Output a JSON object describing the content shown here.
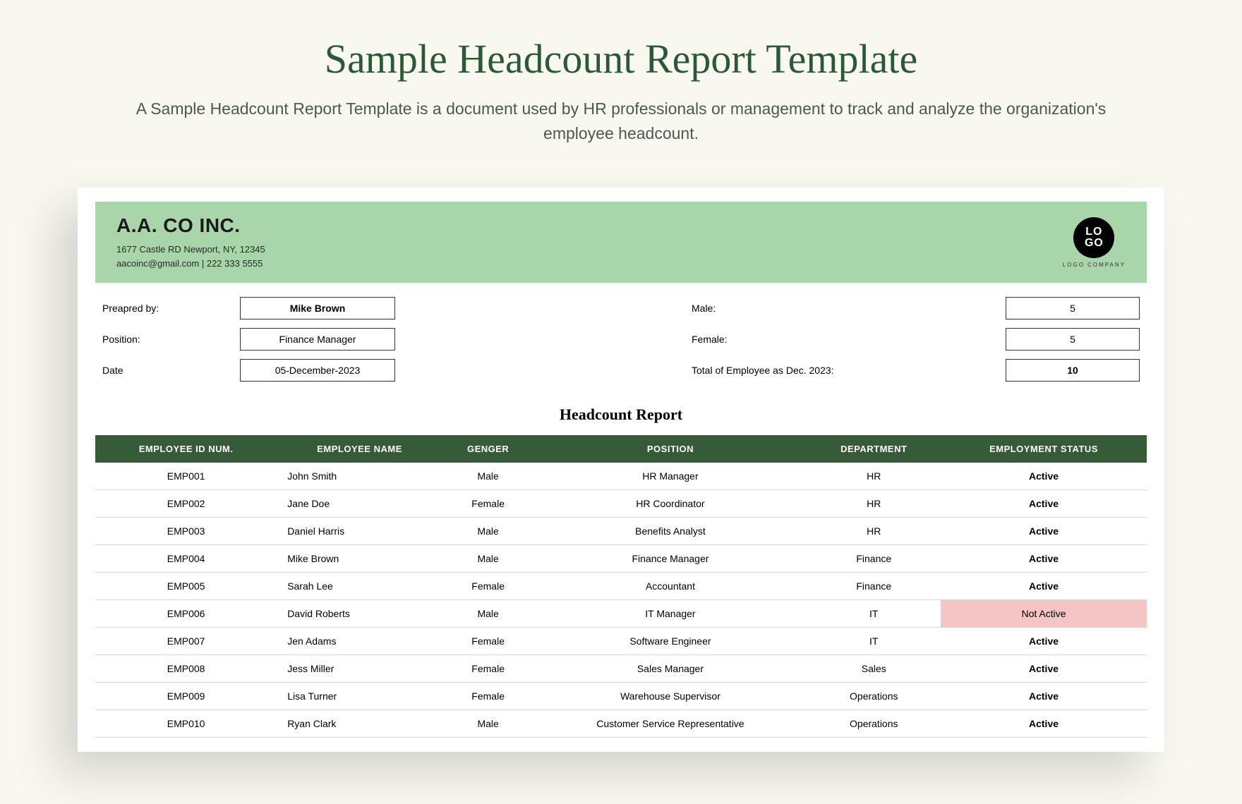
{
  "page": {
    "title": "Sample Headcount Report Template",
    "subtitle": "A Sample Headcount Report Template is a document used by HR professionals or management to track and analyze the organization's employee headcount."
  },
  "header": {
    "company_name": "A.A. CO INC.",
    "company_address": "1677 Castle RD Newport, NY, 12345",
    "company_contact": "aacoinc@gmail.com | 222 333 5555",
    "logo_line1": "LO",
    "logo_line2": "GO",
    "logo_caption": "LOGO COMPANY"
  },
  "meta": {
    "left": [
      {
        "label": "Preapred by:",
        "value": "Mike Brown",
        "bold": true
      },
      {
        "label": "Position:",
        "value": "Finance Manager",
        "bold": false
      },
      {
        "label": "Date",
        "value": "05-December-2023",
        "bold": false
      }
    ],
    "right": [
      {
        "label": "Male:",
        "value": "5"
      },
      {
        "label": "Female:",
        "value": "5"
      },
      {
        "label": "Total of Employee as Dec. 2023:",
        "value": "10"
      }
    ]
  },
  "report_title": "Headcount Report",
  "table": {
    "columns": [
      "EMPLOYEE ID NUM.",
      "EMPLOYEE NAME",
      "GENGER",
      "POSITION",
      "DEPARTMENT",
      "EMPLOYMENT STATUS"
    ],
    "rows": [
      {
        "id": "EMP001",
        "name": "John Smith",
        "gender": "Male",
        "position": "HR Manager",
        "department": "HR",
        "status": "Active"
      },
      {
        "id": "EMP002",
        "name": "Jane Doe",
        "gender": "Female",
        "position": "HR Coordinator",
        "department": "HR",
        "status": "Active"
      },
      {
        "id": "EMP003",
        "name": "Daniel Harris",
        "gender": "Male",
        "position": "Benefits Analyst",
        "department": "HR",
        "status": "Active"
      },
      {
        "id": "EMP004",
        "name": "Mike Brown",
        "gender": "Male",
        "position": "Finance Manager",
        "department": "Finance",
        "status": "Active"
      },
      {
        "id": "EMP005",
        "name": "Sarah Lee",
        "gender": "Female",
        "position": "Accountant",
        "department": "Finance",
        "status": "Active"
      },
      {
        "id": "EMP006",
        "name": "David Roberts",
        "gender": "Male",
        "position": "IT Manager",
        "department": "IT",
        "status": "Not Active"
      },
      {
        "id": "EMP007",
        "name": "Jen Adams",
        "gender": "Female",
        "position": "Software Engineer",
        "department": "IT",
        "status": "Active"
      },
      {
        "id": "EMP008",
        "name": "Jess Miller",
        "gender": "Female",
        "position": "Sales Manager",
        "department": "Sales",
        "status": "Active"
      },
      {
        "id": "EMP009",
        "name": "Lisa Turner",
        "gender": "Female",
        "position": "Warehouse Supervisor",
        "department": "Operations",
        "status": "Active"
      },
      {
        "id": "EMP010",
        "name": "Ryan Clark",
        "gender": "Male",
        "position": "Customer Service Representative",
        "department": "Operations",
        "status": "Active"
      }
    ]
  }
}
